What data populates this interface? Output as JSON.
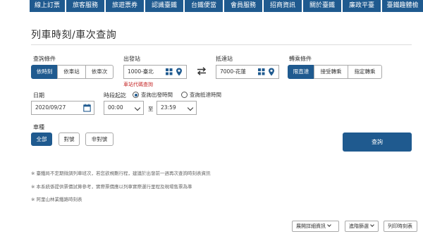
{
  "topnav": [
    "線上訂票",
    "旅客服務",
    "旅遊票券",
    "認識臺鐵",
    "台鐵便當",
    "會員服務",
    "招商資訊",
    "關於臺鐵",
    "廉政平臺",
    "臺鐵趣體檢"
  ],
  "page_title": "列車時刻/車次查詢",
  "query": {
    "label": "查詢條件",
    "options": [
      "依時刻",
      "依車站",
      "依車次"
    ],
    "selected": "依時刻"
  },
  "departure": {
    "label": "出發站",
    "value": "1000-臺北"
  },
  "arrival": {
    "label": "抵達站",
    "value": "7000-花蓮"
  },
  "station_code_link": "車站代碼查詢",
  "transfer": {
    "label": "轉乘條件",
    "options": [
      "限直達",
      "接受轉乘",
      "指定轉乘"
    ],
    "selected": "限直達"
  },
  "date": {
    "label": "日期",
    "value": "2020/09/27"
  },
  "time_period": {
    "label": "時段起訖",
    "radio_departure": "查詢出發時間",
    "radio_arrival": "查詢抵達時間",
    "from": "00:00",
    "to_label": "至",
    "to": "23:59"
  },
  "train_type": {
    "label": "車種",
    "options": [
      "全部",
      "對號",
      "非對號"
    ],
    "selected": "全部"
  },
  "query_button": "查詢",
  "notes": [
    "※ 臺鐵局不定期微調列車班次，若您欲規劃行程，建議於出發前一週再次查詢時刻表資訊",
    "※ 本系統係提供票價試算參考，實際票價應以列車實際運行里程及現場售票為準",
    "※ 阿里山林業鐵路時刻表"
  ],
  "bottom_buttons": [
    "展開詳細資訊",
    "進階篩選",
    "列印時刻表"
  ],
  "colors": {
    "primary": "#1f5a8f",
    "hint": "#c62828"
  },
  "icons": [
    "grid-icon",
    "location-pin-icon",
    "swap-icon",
    "calendar-icon",
    "chevron-down-icon"
  ]
}
